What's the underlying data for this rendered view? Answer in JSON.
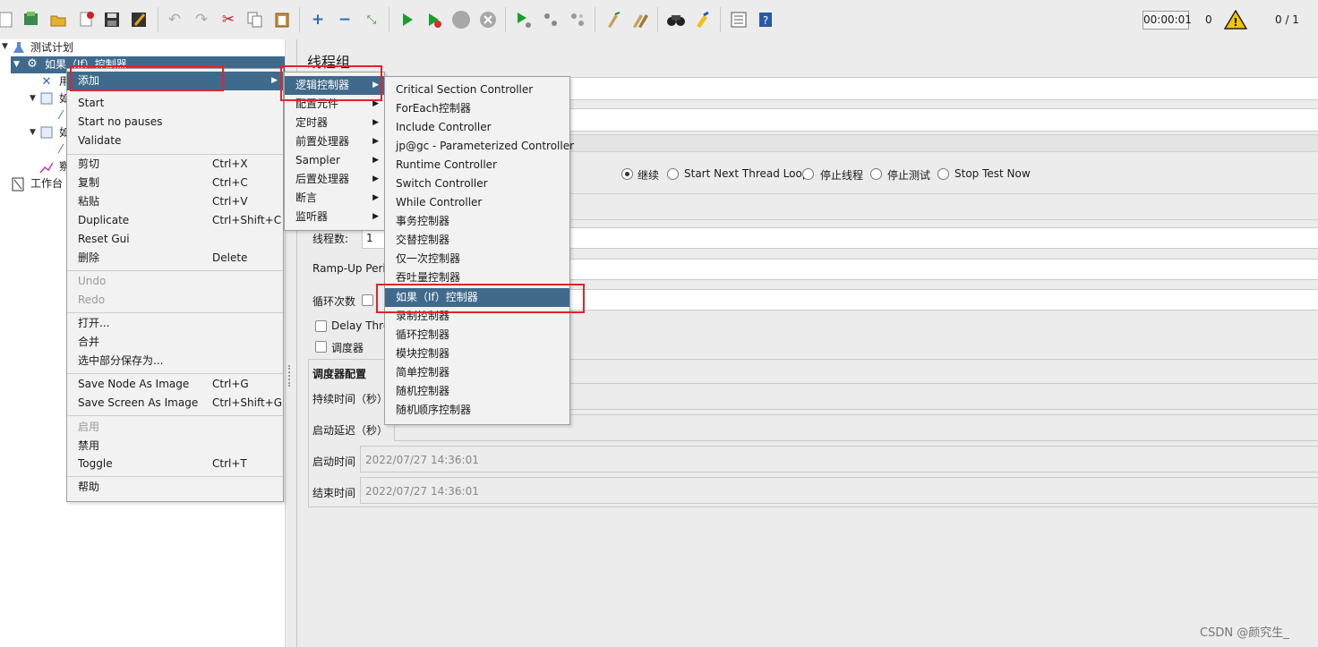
{
  "toolbar": {
    "icons": [
      "new-icon",
      "templates-icon",
      "open-icon",
      "close-icon",
      "save-icon",
      "save-as-icon",
      "undo-icon",
      "redo-icon",
      "cut-icon",
      "copy-icon",
      "paste-icon",
      "expand-icon",
      "collapse-icon",
      "toggle-icon",
      "start-icon",
      "start-no-pauses-icon",
      "stop-icon",
      "shutdown-icon",
      "remote-start-icon",
      "remote-stop-icon",
      "remote-shutdown-icon",
      "clear-icon",
      "clear-all-icon",
      "search-icon",
      "reset-search-icon",
      "function-helper-icon",
      "help-icon"
    ],
    "timer": "00:00:01",
    "error_count": "0",
    "threads": "0 / 1",
    "warn_color": "#f5c400"
  },
  "tree": {
    "root": "测试计划",
    "selected": "如果（If）控制器",
    "workbench": "工作台",
    "partial_items": [
      "用",
      "如",
      "如",
      "察"
    ]
  },
  "main": {
    "title": "线程组",
    "error_action": {
      "options": [
        "继续",
        "Start Next Thread Loop",
        "停止线程",
        "停止测试",
        "Stop Test Now"
      ],
      "selected": "继续"
    },
    "threads_label": "线程数:",
    "threads_value": "1",
    "rampup_label": "Ramp-Up Peri",
    "loop_label": "循环次数",
    "delay_label": "Delay Thre",
    "scheduler_label": "调度器",
    "scheduler_config": "调度器配置",
    "duration_label": "持续时间（秒）",
    "startup_delay_label": "启动延迟（秒）",
    "start_time_label": "启动时间",
    "start_time_value": "2022/07/27 14:36:01",
    "end_time_label": "结束时间",
    "end_time_value": "2022/07/27 14:36:01"
  },
  "context_menu": {
    "items": [
      {
        "label": "添加",
        "shortcut": "",
        "selected": true,
        "submenu": true
      },
      {
        "label": "Start",
        "shortcut": ""
      },
      {
        "label": "Start no pauses",
        "shortcut": ""
      },
      {
        "label": "Validate",
        "shortcut": ""
      },
      {
        "label": "剪切",
        "shortcut": "Ctrl+X"
      },
      {
        "label": "复制",
        "shortcut": "Ctrl+C"
      },
      {
        "label": "粘贴",
        "shortcut": "Ctrl+V"
      },
      {
        "label": "Duplicate",
        "shortcut": "Ctrl+Shift+C"
      },
      {
        "label": "Reset Gui",
        "shortcut": ""
      },
      {
        "label": "删除",
        "shortcut": "Delete"
      },
      {
        "label": "Undo",
        "shortcut": "",
        "disabled": true
      },
      {
        "label": "Redo",
        "shortcut": "",
        "disabled": true
      },
      {
        "label": "打开...",
        "shortcut": ""
      },
      {
        "label": "合并",
        "shortcut": ""
      },
      {
        "label": "选中部分保存为...",
        "shortcut": ""
      },
      {
        "label": "Save Node As Image",
        "shortcut": "Ctrl+G"
      },
      {
        "label": "Save Screen As Image",
        "shortcut": "Ctrl+Shift+G"
      },
      {
        "label": "启用",
        "shortcut": "",
        "disabled": true
      },
      {
        "label": "禁用",
        "shortcut": ""
      },
      {
        "label": "Toggle",
        "shortcut": "Ctrl+T"
      },
      {
        "label": "帮助",
        "shortcut": ""
      }
    ]
  },
  "add_submenu": {
    "items": [
      {
        "label": "逻辑控制器",
        "selected": true
      },
      {
        "label": "配置元件"
      },
      {
        "label": "定时器"
      },
      {
        "label": "前置处理器"
      },
      {
        "label": "Sampler"
      },
      {
        "label": "后置处理器"
      },
      {
        "label": "断言"
      },
      {
        "label": "监听器"
      }
    ]
  },
  "logic_submenu": {
    "items": [
      {
        "label": "Critical Section Controller"
      },
      {
        "label": "ForEach控制器"
      },
      {
        "label": "Include Controller"
      },
      {
        "label": "jp@gc - Parameterized Controller"
      },
      {
        "label": "Runtime Controller"
      },
      {
        "label": "Switch Controller"
      },
      {
        "label": "While Controller"
      },
      {
        "label": "事务控制器"
      },
      {
        "label": "交替控制器"
      },
      {
        "label": "仅一次控制器"
      },
      {
        "label": "吞吐量控制器"
      },
      {
        "label": "如果（If）控制器",
        "selected": true
      },
      {
        "label": "录制控制器"
      },
      {
        "label": "循环控制器"
      },
      {
        "label": "模块控制器"
      },
      {
        "label": "简单控制器"
      },
      {
        "label": "随机控制器"
      },
      {
        "label": "随机顺序控制器"
      }
    ]
  },
  "colors": {
    "selection": "#3f6a8c",
    "highlight_box": "#e0242b"
  },
  "watermark": "CSDN @颜究生_"
}
